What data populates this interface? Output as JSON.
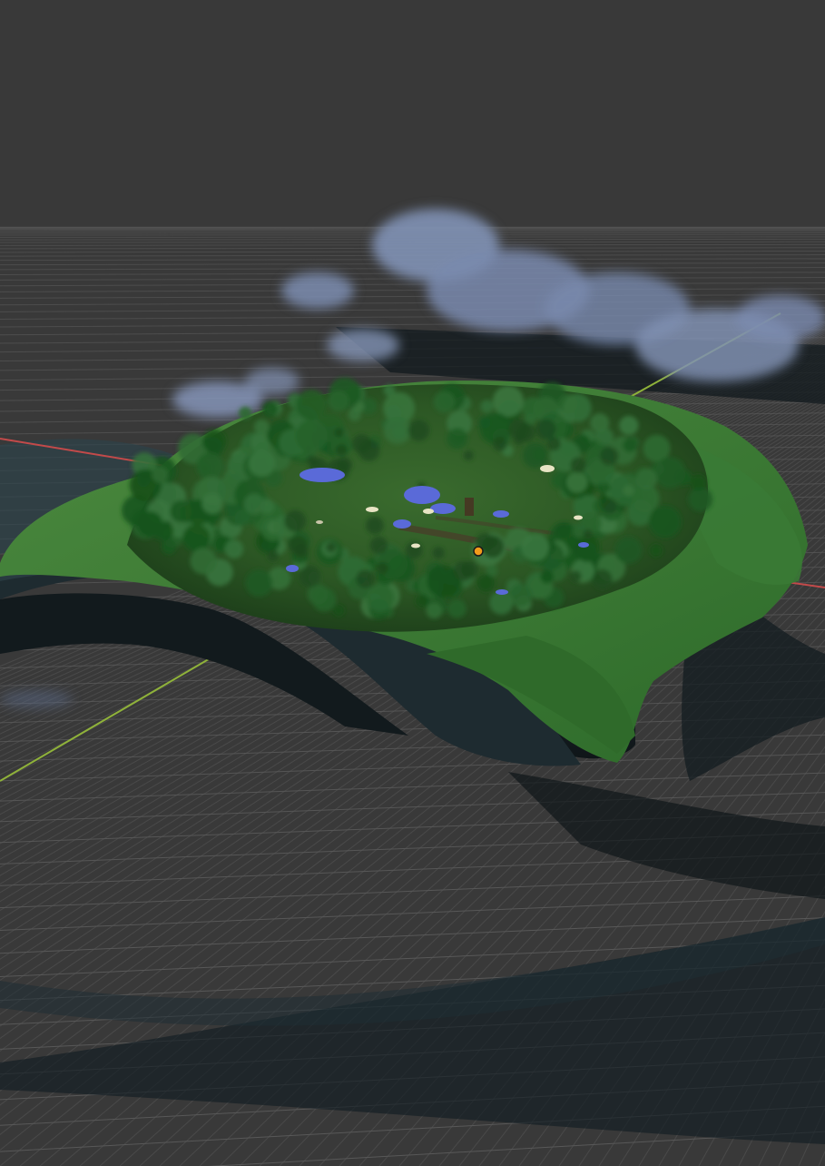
{
  "viewport": {
    "background_color": "#393939",
    "grid_color": "#5a5a5a",
    "x_axis_color": "#c24a4a",
    "y_axis_color": "#8fb23a",
    "terrain_colors": {
      "grass_light": "#3f7a35",
      "grass_dark": "#24501f",
      "cliff": "#1a262b",
      "rock": "#2a3a40",
      "cloud": "#8a9cc0",
      "water": "#5a6ad8"
    },
    "origin_marker_color": "#f29b1b"
  }
}
